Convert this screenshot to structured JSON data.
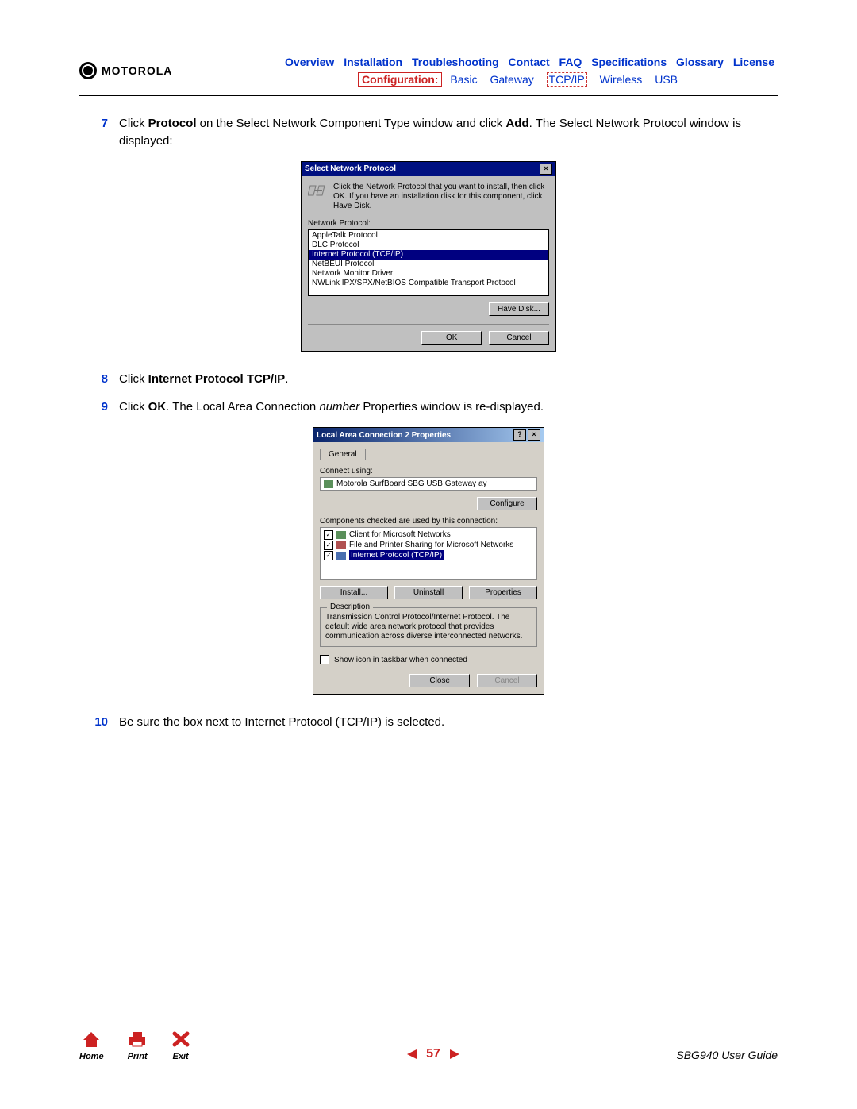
{
  "brand": "MOTOROLA",
  "nav1": {
    "overview": "Overview",
    "installation": "Installation",
    "troubleshooting": "Troubleshooting",
    "contact": "Contact",
    "faq": "FAQ",
    "specifications": "Specifications",
    "glossary": "Glossary",
    "license": "License"
  },
  "nav2": {
    "configuration": "Configuration:",
    "basic": "Basic",
    "gateway": "Gateway",
    "tcpip": "TCP/IP",
    "wireless": "Wireless",
    "usb": "USB"
  },
  "steps": {
    "s7": {
      "num": "7",
      "pre": "Click ",
      "b1": "Protocol",
      "mid": " on the Select Network Component Type window and click ",
      "b2": "Add",
      "post": ". The Select Network Protocol window is displayed:"
    },
    "s8": {
      "num": "8",
      "pre": "Click ",
      "b1": "Internet Protocol TCP/IP",
      "post": "."
    },
    "s9": {
      "num": "9",
      "pre": "Click ",
      "b1": "OK",
      "mid1": ". The Local Area Connection ",
      "it": "number",
      "mid2": " Properties window is re-displayed."
    },
    "s10": {
      "num": "10",
      "text": "Be sure the box next to Internet Protocol (TCP/IP) is selected."
    }
  },
  "dlg1": {
    "title": "Select Network Protocol",
    "instr": "Click the Network Protocol that you want to install, then click OK. If you have an installation disk for this component, click Have Disk.",
    "list_label": "Network Protocol:",
    "items": {
      "a": "AppleTalk Protocol",
      "b": "DLC Protocol",
      "c": "Internet Protocol (TCP/IP)",
      "d": "NetBEUI Protocol",
      "e": "Network Monitor Driver",
      "f": "NWLink IPX/SPX/NetBIOS Compatible Transport Protocol"
    },
    "have_disk": "Have Disk...",
    "ok": "OK",
    "cancel": "Cancel"
  },
  "dlg2": {
    "title": "Local Area Connection 2 Properties",
    "tab_general": "General",
    "connect_using_label": "Connect using:",
    "adapter": "Motorola SurfBoard SBG USB Gateway   ay",
    "configure": "Configure",
    "components_label": "Components checked are used by this connection:",
    "comp": {
      "a": "Client for Microsoft Networks",
      "b": "File and Printer Sharing for Microsoft Networks",
      "c": "Internet Protocol (TCP/IP)"
    },
    "install": "Install...",
    "uninstall": "Uninstall",
    "properties": "Properties",
    "desc_label": "Description",
    "desc": "Transmission Control Protocol/Internet Protocol. The default wide area network protocol that provides communication across diverse interconnected networks.",
    "show_icon": "Show icon in taskbar when connected",
    "close": "Close",
    "cancel": "Cancel"
  },
  "footer": {
    "home": "Home",
    "print": "Print",
    "exit": "Exit",
    "page": "57",
    "guide": "SBG940 User Guide"
  }
}
